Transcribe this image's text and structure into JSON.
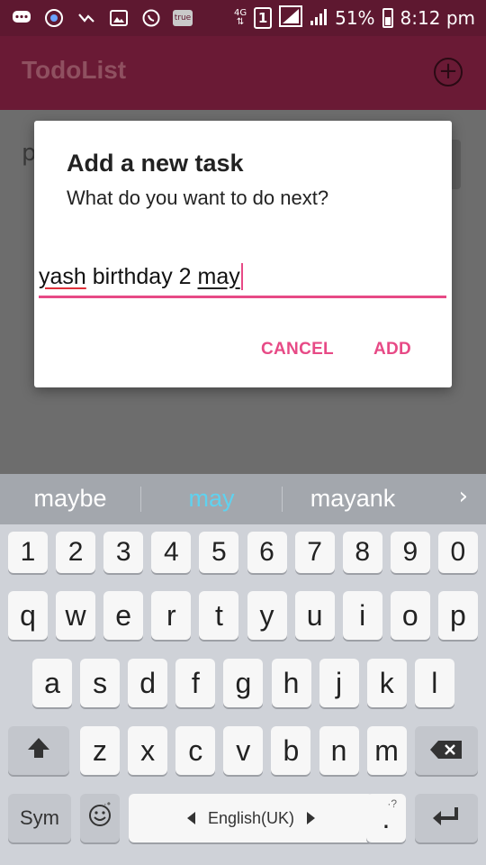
{
  "status_bar": {
    "battery": "51%",
    "time": "8:12 pm",
    "network": "4G",
    "sim": "1",
    "true_badge": "true"
  },
  "app_bar": {
    "title": "TodoList",
    "add_icon": "add-circle-icon"
  },
  "background": {
    "list_peek": "p"
  },
  "dialog": {
    "title": "Add a new task",
    "message": "What do you want to do next?",
    "input_words": [
      "yash",
      " birthday 2 ",
      "may"
    ],
    "cancel_label": "CANCEL",
    "add_label": "ADD"
  },
  "keyboard": {
    "suggestions": [
      "maybe",
      "may",
      "mayank"
    ],
    "suggestion_next": "›",
    "number_row": [
      "1",
      "2",
      "3",
      "4",
      "5",
      "6",
      "7",
      "8",
      "9",
      "0"
    ],
    "row1": [
      "q",
      "w",
      "e",
      "r",
      "t",
      "y",
      "u",
      "i",
      "o",
      "p"
    ],
    "row2": [
      "a",
      "s",
      "d",
      "f",
      "g",
      "h",
      "j",
      "k",
      "l"
    ],
    "row3": [
      "z",
      "x",
      "c",
      "v",
      "b",
      "n",
      "m"
    ],
    "sym_label": "Sym",
    "space_label": "English(UK)",
    "period_label": ".",
    "shift_icon": "shift-icon",
    "backspace_icon": "backspace-icon",
    "enter_icon": "enter-icon",
    "emoji_icon": "emoji-icon",
    "accent_color": "#e74a86"
  }
}
